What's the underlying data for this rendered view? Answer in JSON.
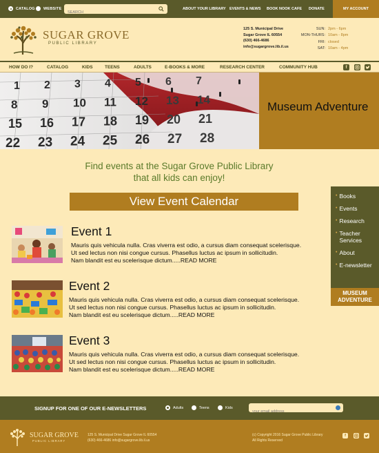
{
  "topbar": {
    "radio_catalog": "CATALOG",
    "radio_website": "WEBSITE",
    "search_placeholder": "SEARCH",
    "links": [
      "ABOUT YOUR LIBRARY",
      "EVENTS & NEWS",
      "BOOK NOOK CAFE",
      "DONATE"
    ],
    "my_account": "MY ACCOUNT"
  },
  "header": {
    "logo_title": "SUGAR GROVE",
    "logo_subtitle": "PUBLIC LIBRARY",
    "address": [
      "125 S. Municipal Drive",
      "Sugar Grove IL 60554",
      "(630) 466-4686",
      "info@sugargrove.lib.il.us"
    ],
    "hours": [
      {
        "day": "SUN:",
        "time": "2pm - 6pm"
      },
      {
        "day": "MON-THURS:",
        "time": "10am - 8pm"
      },
      {
        "day": "FRI:",
        "time": "closed"
      },
      {
        "day": "SAT:",
        "time": "10am - 4pm"
      }
    ]
  },
  "nav": {
    "items": [
      "HOW DO I?",
      "CATALOG",
      "KIDS",
      "TEENS",
      "ADULTS",
      "E-BOOKS & MORE",
      "RESEARCH CENTER",
      "COMMUNITY HUB"
    ]
  },
  "hero": {
    "title": "Museum Adventure",
    "calendar_numbers": [
      "1",
      "2",
      "3",
      "4",
      "5",
      "6",
      "7",
      "8",
      "9",
      "10",
      "11",
      "12",
      "13",
      "14",
      "15",
      "16",
      "17",
      "18",
      "19",
      "20",
      "21",
      "22",
      "23",
      "24",
      "25",
      "26",
      "27",
      "28"
    ]
  },
  "tagline": {
    "line1": "Find events at the Sugar Grove Public Library",
    "line2": "that all kids can enjoy!"
  },
  "cta": {
    "label": "View Event Calendar"
  },
  "side_menu": {
    "items": [
      "Books",
      "Events",
      "Research",
      "Teacher Services",
      "About",
      "E-newsletter"
    ],
    "feature": "MUSEUM ADVENTURE"
  },
  "events": [
    {
      "title": "Event 1",
      "lines": [
        "Mauris quis vehicula nulla. Cras viverra est odio, a cursus diam consequat scelerisque.",
        "Ut sed lectus non nisi congue cursus. Phasellus luctus ac ipsum in sollicitudin.",
        "Nam blandit est eu scelerisque dictum.....READ MORE"
      ]
    },
    {
      "title": "Event 2",
      "lines": [
        "Mauris quis vehicula nulla. Cras viverra est odio, a cursus diam consequat scelerisque.",
        "Ut sed lectus non nisi congue cursus. Phasellus luctus ac ipsum in sollicitudin.",
        "Nam blandit est eu scelerisque dictum.....READ MORE"
      ]
    },
    {
      "title": "Event 3",
      "lines": [
        "Mauris quis vehicula nulla. Cras viverra est odio, a cursus diam consequat scelerisque.",
        "Ut sed lectus non nisi congue cursus. Phasellus luctus ac ipsum in sollicitudin.",
        "Nam blandit est eu scelerisque dictum.....READ MORE"
      ]
    }
  ],
  "signup": {
    "label": "SIGNUP FOR ONE OF OUR E-NEWSLETTERS",
    "options": [
      "Adults",
      "Teens",
      "Kids"
    ],
    "email_placeholder": "your email address"
  },
  "footer": {
    "logo_title": "SUGAR GROVE",
    "logo_subtitle": "PUBLIC LIBRARY",
    "address_line1": "125 S. Municipal Drive Sugar Grove IL 60554",
    "address_line2": "(630) 466-4686    info@sugargrove.lib.il.us",
    "copyright_line1": "(c) Copyright 2016 Sugar Grove Public Library",
    "copyright_line2": "All Rights Reserved"
  },
  "colors": {
    "olive": "#5a5a2a",
    "gold": "#b07d20",
    "cream": "#fdeab8",
    "tagline_green": "#5a7a2a"
  },
  "icons": {
    "social": [
      "facebook-icon",
      "instagram-icon",
      "twitter-icon"
    ],
    "search": "search-icon"
  }
}
